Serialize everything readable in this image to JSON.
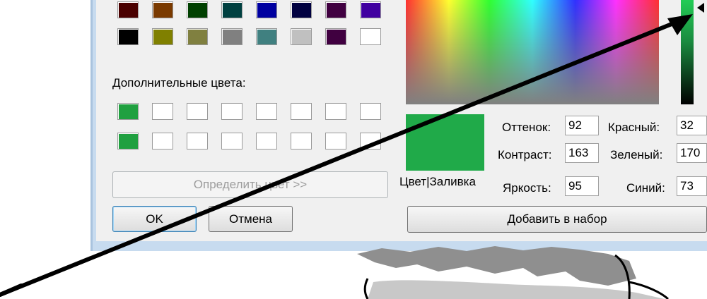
{
  "basic_colors_row1": [
    "#4a0000",
    "#7a3a00",
    "#004000",
    "#004040",
    "#0000a0",
    "#000040",
    "#400040",
    "#4000a0"
  ],
  "basic_colors_row2": [
    "#000000",
    "#808000",
    "#808040",
    "#808080",
    "#408080",
    "#c0c0c0",
    "#400040",
    "#ffffff"
  ],
  "custom_colors_label": "Дополнительные цвета:",
  "custom_colors": [
    "#20a040",
    "",
    "",
    "",
    "",
    "",
    "",
    "",
    "#20a040",
    "",
    "",
    "",
    "",
    "",
    "",
    ""
  ],
  "define_button": "Определить цвет >>",
  "ok_button": "OK",
  "cancel_button": "Отмена",
  "preview_label": "Цвет|Заливка",
  "preview_color": "#20aa49",
  "fields": {
    "hue_label": "Оттенок:",
    "hue_value": "92",
    "sat_label": "Контраст:",
    "sat_value": "163",
    "lum_label": "Яркость:",
    "lum_value": "95",
    "red_label": "Красный:",
    "red_value": "32",
    "green_label": "Зеленый:",
    "green_value": "170",
    "blue_label": "Синий:",
    "blue_value": "73"
  },
  "add_button": "Добавить в набор"
}
